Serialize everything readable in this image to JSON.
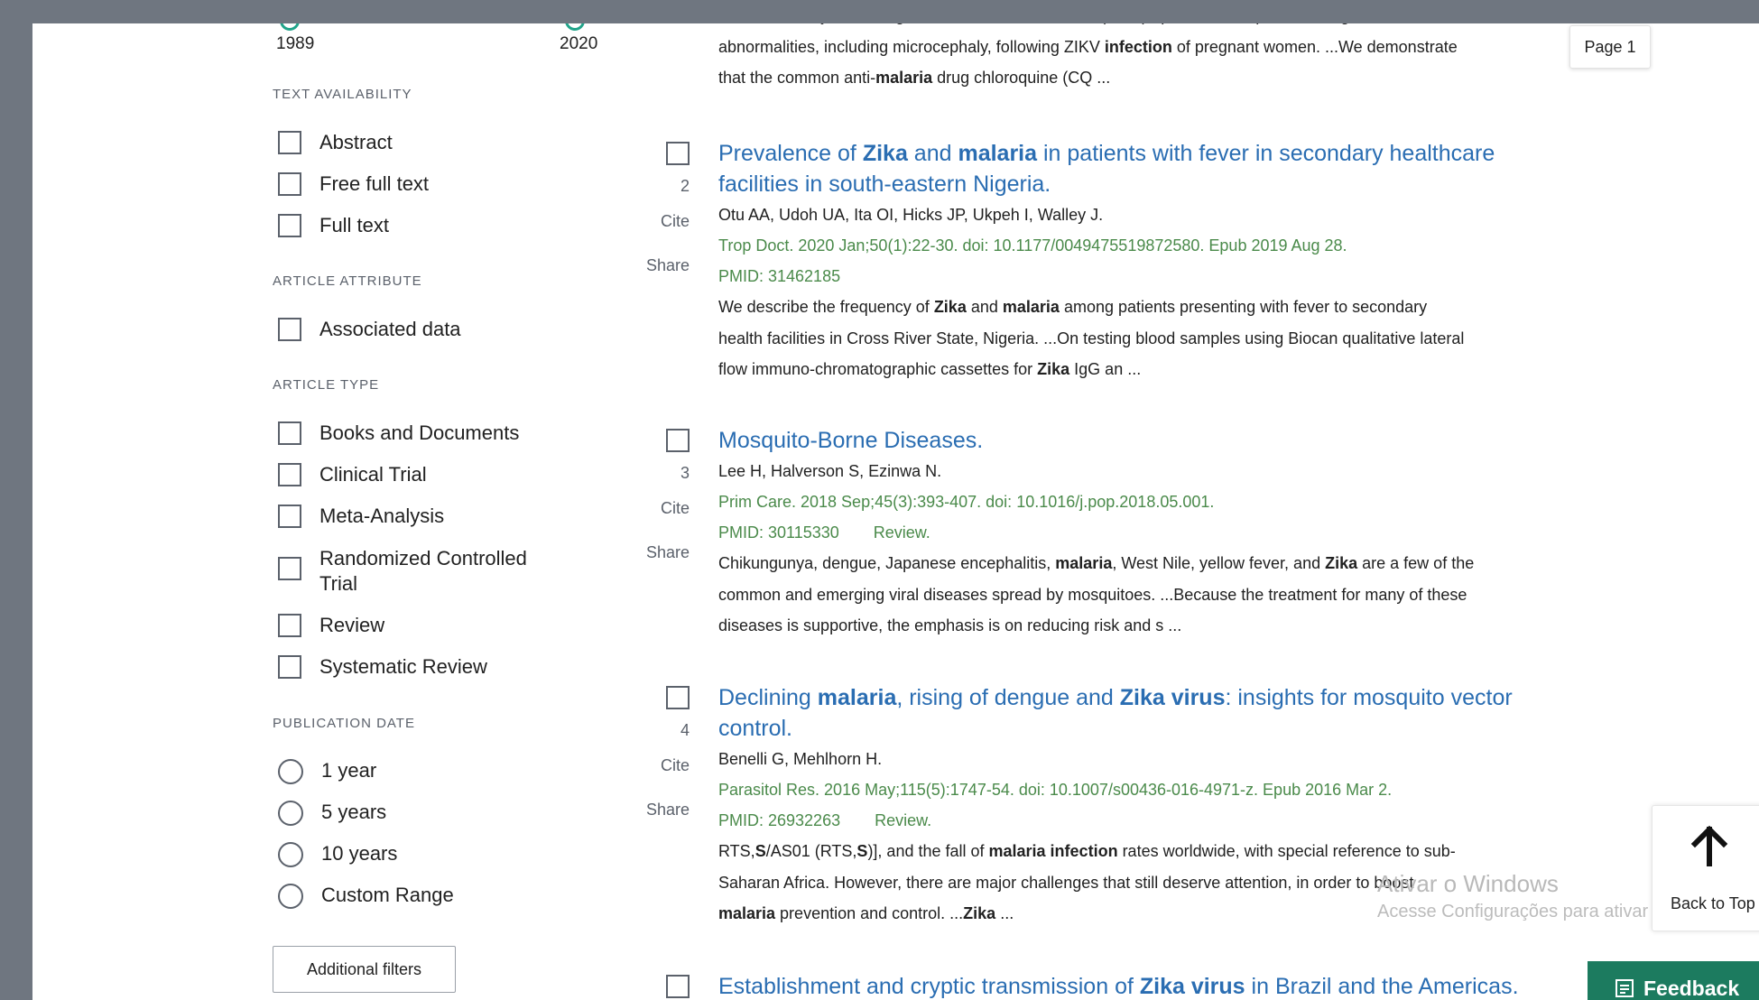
{
  "sidebar": {
    "year_range": {
      "start": "1989",
      "end": "2020"
    },
    "text_availability": {
      "heading": "TEXT AVAILABILITY",
      "items": [
        "Abstract",
        "Free full text",
        "Full text"
      ]
    },
    "article_attribute": {
      "heading": "ARTICLE ATTRIBUTE",
      "items": [
        "Associated data"
      ]
    },
    "article_type": {
      "heading": "ARTICLE TYPE",
      "items": [
        "Books and Documents",
        "Clinical Trial",
        "Meta-Analysis",
        "Randomized Controlled Trial",
        "Review",
        "Systematic Review"
      ]
    },
    "publication_date": {
      "heading": "PUBLICATION DATE",
      "items": [
        "1 year",
        "5 years",
        "10 years",
        "Custom Range"
      ]
    },
    "additional_filters": "Additional filters"
  },
  "results": {
    "top_snippet": {
      "line1": "One of the major challenges of the current Zika virus (ZIKV) epidemic is to prevent congenital foetal",
      "line2_parts": [
        "abnormalities, including microcephaly, following ZIKV ",
        "infection",
        " of pregnant women. ...We demonstrate"
      ],
      "line3_parts": [
        "that the common anti-",
        "malaria",
        " drug chloroquine (CQ ..."
      ]
    },
    "labels": {
      "cite": "Cite",
      "share": "Share"
    },
    "articles": [
      {
        "number": "2",
        "title_line1_parts": [
          "Prevalence of ",
          "Zika",
          " and ",
          "malaria",
          " in patients with fever in secondary healthcare"
        ],
        "title_line2": "facilities in south-eastern Nigeria.",
        "authors": "Otu AA, Udoh UA, Ita OI, Hicks JP, Ukpeh I, Walley J.",
        "citation": "Trop Doct. 2020 Jan;50(1):22-30. doi: 10.1177/0049475519872580. Epub 2019 Aug 28.",
        "pmid": "PMID: 31462185",
        "type": "",
        "snippet_l1_parts": [
          "We describe the frequency of ",
          "Zika",
          " and ",
          "malaria",
          " among patients presenting with fever to secondary"
        ],
        "snippet_l2": "health facilities in Cross River State, Nigeria. ...On testing blood samples using Biocan qualitative lateral",
        "snippet_l3_parts": [
          "flow immuno-chromatographic cassettes for ",
          "Zika",
          " IgG an ..."
        ]
      },
      {
        "number": "3",
        "title": "Mosquito-Borne Diseases.",
        "authors": "Lee H, Halverson S, Ezinwa N.",
        "citation": "Prim Care. 2018 Sep;45(3):393-407. doi: 10.1016/j.pop.2018.05.001.",
        "pmid": "PMID: 30115330",
        "type": "Review.",
        "snippet_l1_parts": [
          "Chikungunya, dengue, Japanese encephalitis, ",
          "malaria",
          ", West Nile, yellow fever, and ",
          "Zika",
          " are a few of the"
        ],
        "snippet_l2": "common and emerging viral diseases spread by mosquitoes. ...Because the treatment for many of these",
        "snippet_l3": "diseases is supportive, the emphasis is on reducing risk and s ..."
      },
      {
        "number": "4",
        "title_line1_parts": [
          "Declining ",
          "malaria",
          ", rising of dengue and ",
          "Zika virus",
          ": insights for mosquito vector"
        ],
        "title_line2": "control.",
        "authors": "Benelli G, Mehlhorn H.",
        "citation": "Parasitol Res. 2016 May;115(5):1747-54. doi: 10.1007/s00436-016-4971-z. Epub 2016 Mar 2.",
        "pmid": "PMID: 26932263",
        "type": "Review.",
        "snippet_l1_parts": [
          "RTS,",
          "S",
          "/AS01 (RTS,",
          "S",
          ")], and the fall of ",
          "malaria infection",
          " rates worldwide, with special reference to sub-"
        ],
        "snippet_l2": "Saharan Africa. However, there are major challenges that still deserve attention, in order to boost",
        "snippet_l3_parts": [
          "malaria",
          " prevention and control. ...",
          "Zika",
          " ..."
        ]
      },
      {
        "title_parts": [
          "Establishment and cryptic transmission of ",
          "Zika virus",
          " in Brazil and the Americas."
        ]
      }
    ]
  },
  "page_badge": "Page 1",
  "back_to_top": "Back to Top",
  "feedback": "Feedback",
  "watermark": {
    "title": "Ativar o Windows",
    "subtitle": "Acesse Configurações para ativar o Windows."
  }
}
